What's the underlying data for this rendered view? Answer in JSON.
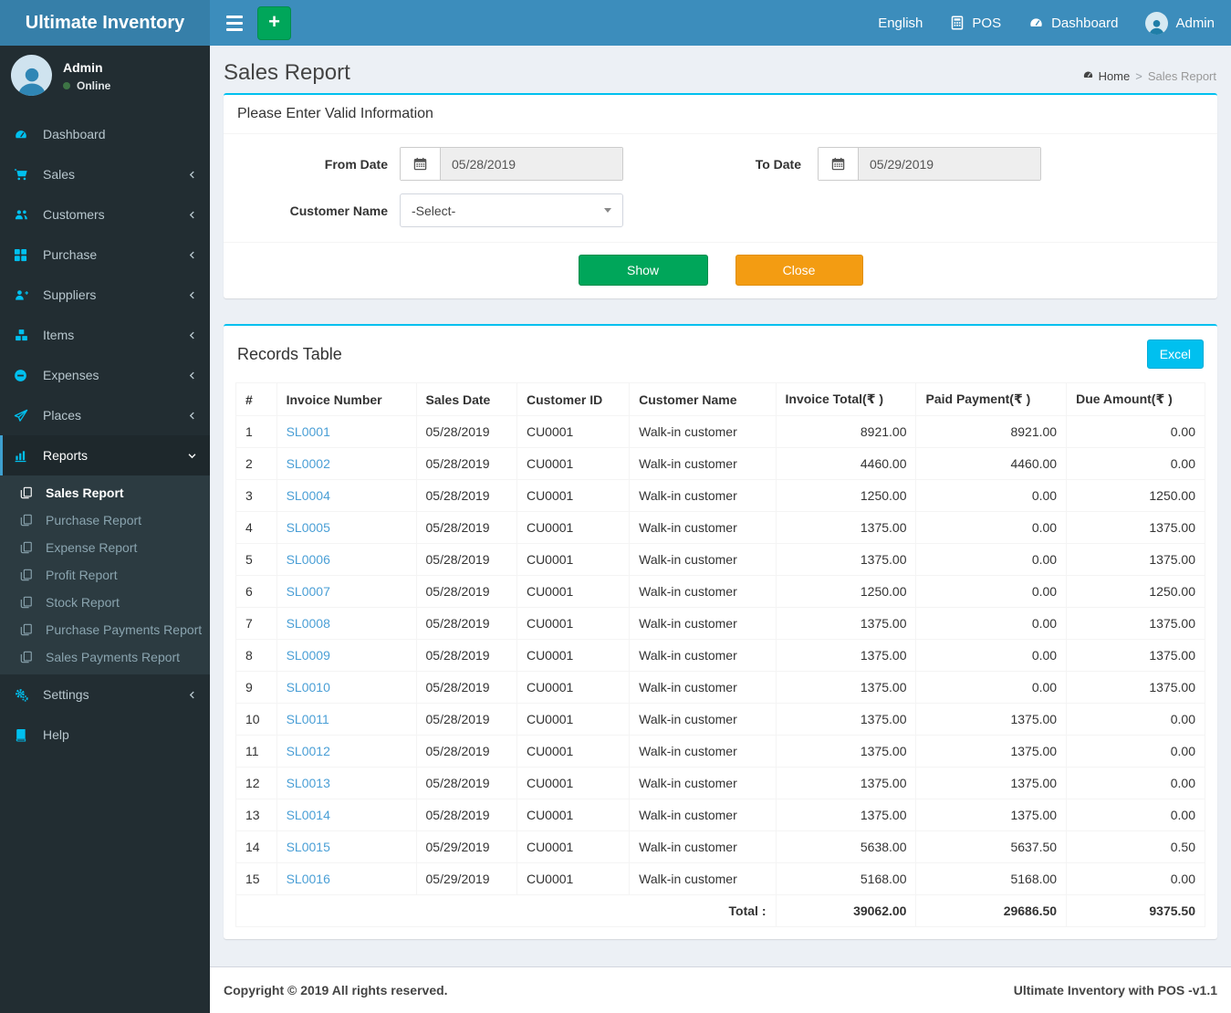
{
  "navbar": {
    "brand": "Ultimate Inventory",
    "add_label": "+",
    "language_label": "English",
    "pos_label": "POS",
    "dashboard_label": "Dashboard",
    "user_label": "Admin"
  },
  "sidebar": {
    "user_name": "Admin",
    "user_status": "Online",
    "items": [
      {
        "label": "Dashboard",
        "icon": "tachometer-icon",
        "expandable": false
      },
      {
        "label": "Sales",
        "icon": "cart-icon",
        "expandable": true
      },
      {
        "label": "Customers",
        "icon": "users-icon",
        "expandable": true
      },
      {
        "label": "Purchase",
        "icon": "grid-icon",
        "expandable": true
      },
      {
        "label": "Suppliers",
        "icon": "user-plus-icon",
        "expandable": true
      },
      {
        "label": "Items",
        "icon": "cubes-icon",
        "expandable": true
      },
      {
        "label": "Expenses",
        "icon": "minus-circle-icon",
        "expandable": true
      },
      {
        "label": "Places",
        "icon": "paper-plane-icon",
        "expandable": true
      },
      {
        "label": "Reports",
        "icon": "bar-chart-icon",
        "expandable": true,
        "active": true
      },
      {
        "label": "Settings",
        "icon": "gears-icon",
        "expandable": true
      },
      {
        "label": "Help",
        "icon": "book-icon",
        "expandable": false
      }
    ],
    "reports_submenu": [
      "Sales Report",
      "Purchase Report",
      "Expense Report",
      "Profit Report",
      "Stock Report",
      "Purchase Payments Report",
      "Sales Payments Report"
    ],
    "reports_submenu_active": "Sales Report"
  },
  "main": {
    "page_title": "Sales Report",
    "breadcrumb": {
      "home_label": "Home",
      "separator": ">",
      "current": "Sales Report"
    },
    "filter": {
      "heading": "Please Enter Valid Information",
      "from_date_label": "From Date",
      "from_date_value": "05/28/2019",
      "to_date_label": "To Date",
      "to_date_value": "05/29/2019",
      "customer_label": "Customer Name",
      "customer_value": "-Select-",
      "show_label": "Show",
      "close_label": "Close"
    },
    "records": {
      "heading": "Records Table",
      "excel_label": "Excel",
      "columns": [
        "#",
        "Invoice Number",
        "Sales Date",
        "Customer ID",
        "Customer Name",
        "Invoice Total(₹ )",
        "Paid Payment(₹ )",
        "Due Amount(₹ )"
      ],
      "rows": [
        [
          "1",
          "SL0001",
          "05/28/2019",
          "CU0001",
          "Walk-in customer",
          "8921.00",
          "8921.00",
          "0.00"
        ],
        [
          "2",
          "SL0002",
          "05/28/2019",
          "CU0001",
          "Walk-in customer",
          "4460.00",
          "4460.00",
          "0.00"
        ],
        [
          "3",
          "SL0004",
          "05/28/2019",
          "CU0001",
          "Walk-in customer",
          "1250.00",
          "0.00",
          "1250.00"
        ],
        [
          "4",
          "SL0005",
          "05/28/2019",
          "CU0001",
          "Walk-in customer",
          "1375.00",
          "0.00",
          "1375.00"
        ],
        [
          "5",
          "SL0006",
          "05/28/2019",
          "CU0001",
          "Walk-in customer",
          "1375.00",
          "0.00",
          "1375.00"
        ],
        [
          "6",
          "SL0007",
          "05/28/2019",
          "CU0001",
          "Walk-in customer",
          "1250.00",
          "0.00",
          "1250.00"
        ],
        [
          "7",
          "SL0008",
          "05/28/2019",
          "CU0001",
          "Walk-in customer",
          "1375.00",
          "0.00",
          "1375.00"
        ],
        [
          "8",
          "SL0009",
          "05/28/2019",
          "CU0001",
          "Walk-in customer",
          "1375.00",
          "0.00",
          "1375.00"
        ],
        [
          "9",
          "SL0010",
          "05/28/2019",
          "CU0001",
          "Walk-in customer",
          "1375.00",
          "0.00",
          "1375.00"
        ],
        [
          "10",
          "SL0011",
          "05/28/2019",
          "CU0001",
          "Walk-in customer",
          "1375.00",
          "1375.00",
          "0.00"
        ],
        [
          "11",
          "SL0012",
          "05/28/2019",
          "CU0001",
          "Walk-in customer",
          "1375.00",
          "1375.00",
          "0.00"
        ],
        [
          "12",
          "SL0013",
          "05/28/2019",
          "CU0001",
          "Walk-in customer",
          "1375.00",
          "1375.00",
          "0.00"
        ],
        [
          "13",
          "SL0014",
          "05/28/2019",
          "CU0001",
          "Walk-in customer",
          "1375.00",
          "1375.00",
          "0.00"
        ],
        [
          "14",
          "SL0015",
          "05/29/2019",
          "CU0001",
          "Walk-in customer",
          "5638.00",
          "5637.50",
          "0.50"
        ],
        [
          "15",
          "SL0016",
          "05/29/2019",
          "CU0001",
          "Walk-in customer",
          "5168.00",
          "5168.00",
          "0.00"
        ]
      ],
      "total_label": "Total :",
      "totals": [
        "39062.00",
        "29686.50",
        "9375.50"
      ]
    }
  },
  "footer": {
    "left": "Copyright © 2019 All rights reserved.",
    "right": "Ultimate Inventory with POS -v1.1"
  },
  "colors": {
    "navbar_blue": "#3c8dbc",
    "logo_blue": "#367fa9",
    "sidebar_dark": "#222d32",
    "submenu_dark": "#2c3b41",
    "accent_cyan": "#00c0ef",
    "active_stripe": "#3ea0d0",
    "show_green": "#00a65a",
    "close_orange": "#f39c12",
    "link_blue": "#4a9fd6",
    "online_green": "#3d7445",
    "content_bg": "#ecf0f5"
  }
}
